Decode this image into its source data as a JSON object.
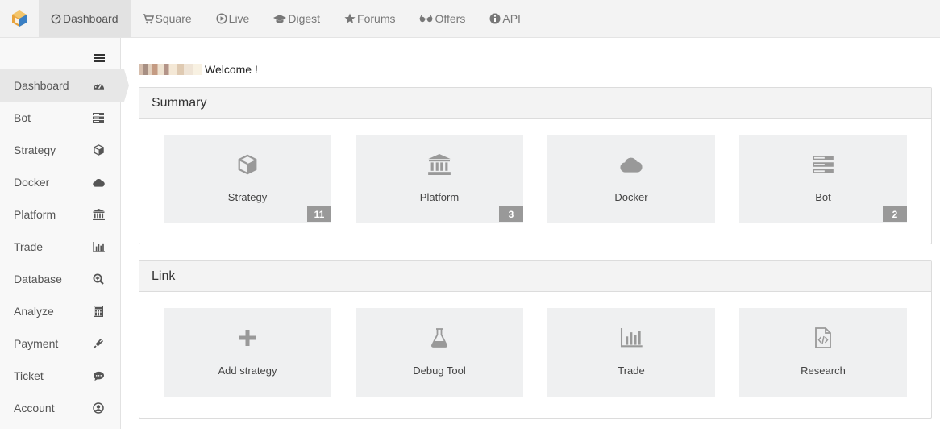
{
  "nav": {
    "items": [
      {
        "label": "Dashboard",
        "icon": "dashboard-circle-icon"
      },
      {
        "label": "Square",
        "icon": "cart-icon"
      },
      {
        "label": "Live",
        "icon": "play-circle-icon"
      },
      {
        "label": "Digest",
        "icon": "graduation-cap-icon"
      },
      {
        "label": "Forums",
        "icon": "star-icon"
      },
      {
        "label": "Offers",
        "icon": "glasses-icon"
      },
      {
        "label": "API",
        "icon": "info-circle-icon"
      }
    ]
  },
  "sidebar": {
    "items": [
      {
        "label": "Dashboard",
        "icon": "tachometer-icon"
      },
      {
        "label": "Bot",
        "icon": "server-icon"
      },
      {
        "label": "Strategy",
        "icon": "cube-icon"
      },
      {
        "label": "Docker",
        "icon": "cloud-icon"
      },
      {
        "label": "Platform",
        "icon": "bank-icon"
      },
      {
        "label": "Trade",
        "icon": "bar-chart-icon"
      },
      {
        "label": "Database",
        "icon": "search-plus-icon"
      },
      {
        "label": "Analyze",
        "icon": "calculator-icon"
      },
      {
        "label": "Payment",
        "icon": "plug-icon"
      },
      {
        "label": "Ticket",
        "icon": "comment-icon"
      },
      {
        "label": "Account",
        "icon": "user-circle-icon"
      }
    ]
  },
  "welcome": {
    "text": "Welcome !"
  },
  "summary": {
    "title": "Summary",
    "tiles": [
      {
        "label": "Strategy",
        "badge": "11",
        "icon": "cube-icon"
      },
      {
        "label": "Platform",
        "badge": "3",
        "icon": "bank-icon"
      },
      {
        "label": "Docker",
        "badge": "",
        "icon": "cloud-icon"
      },
      {
        "label": "Bot",
        "badge": "2",
        "icon": "server-icon"
      }
    ]
  },
  "link": {
    "title": "Link",
    "tiles": [
      {
        "label": "Add strategy",
        "icon": "plus-icon"
      },
      {
        "label": "Debug Tool",
        "icon": "flask-icon"
      },
      {
        "label": "Trade",
        "icon": "bar-chart-icon"
      },
      {
        "label": "Research",
        "icon": "file-code-icon"
      }
    ]
  },
  "colors": {
    "accent_active": "#e2e2e2",
    "tile_bg": "#eff0f1",
    "badge_bg": "#999999"
  }
}
